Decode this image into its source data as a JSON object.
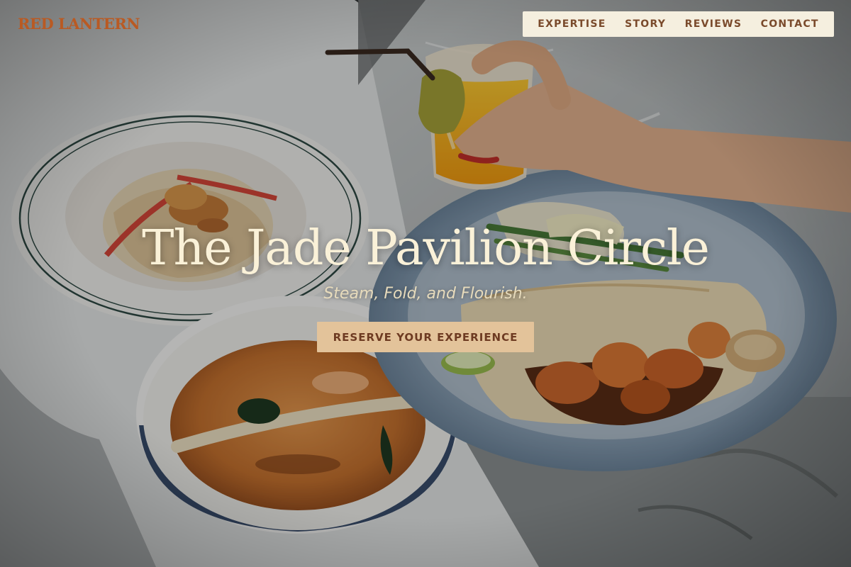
{
  "brand": {
    "name": "RED LANTERN",
    "color": "#b95a23"
  },
  "nav": {
    "items": [
      {
        "label": "EXPERTISE"
      },
      {
        "label": "STORY"
      },
      {
        "label": "REVIEWS"
      },
      {
        "label": "CONTACT"
      }
    ],
    "background": "#f5efdf",
    "text_color": "#7a4a2b"
  },
  "hero": {
    "title": "The Jade Pavilion Circle",
    "tagline": "Steam, Fold, and Flourish.",
    "cta_label": "RESERVE YOUR EXPERIENCE",
    "cta_color": "#e3c39a",
    "title_color": "#faf1d8"
  }
}
